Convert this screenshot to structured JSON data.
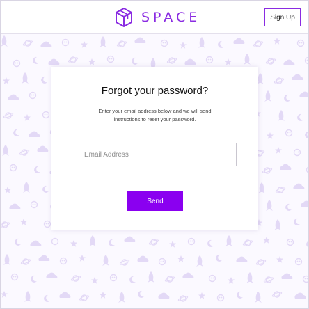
{
  "brand": {
    "name": "SPACE",
    "icon": "cube-icon",
    "color": "#8a2be2"
  },
  "header": {
    "signup_label": "Sign Up"
  },
  "card": {
    "title": "Forgot your password?",
    "description": "Enter your email address below and we will send instructions to reset your password.",
    "email_placeholder": "Email Address",
    "email_value": "",
    "send_label": "Send"
  },
  "theme": {
    "accent": "#8a00f0",
    "pattern_color": "#e3d9f6",
    "background": "#fbf9ff"
  },
  "background_pattern": {
    "icons": [
      "rocket-icon",
      "cloud-icon",
      "star-icon",
      "moon-icon",
      "planet-icon",
      "alien-icon"
    ]
  }
}
